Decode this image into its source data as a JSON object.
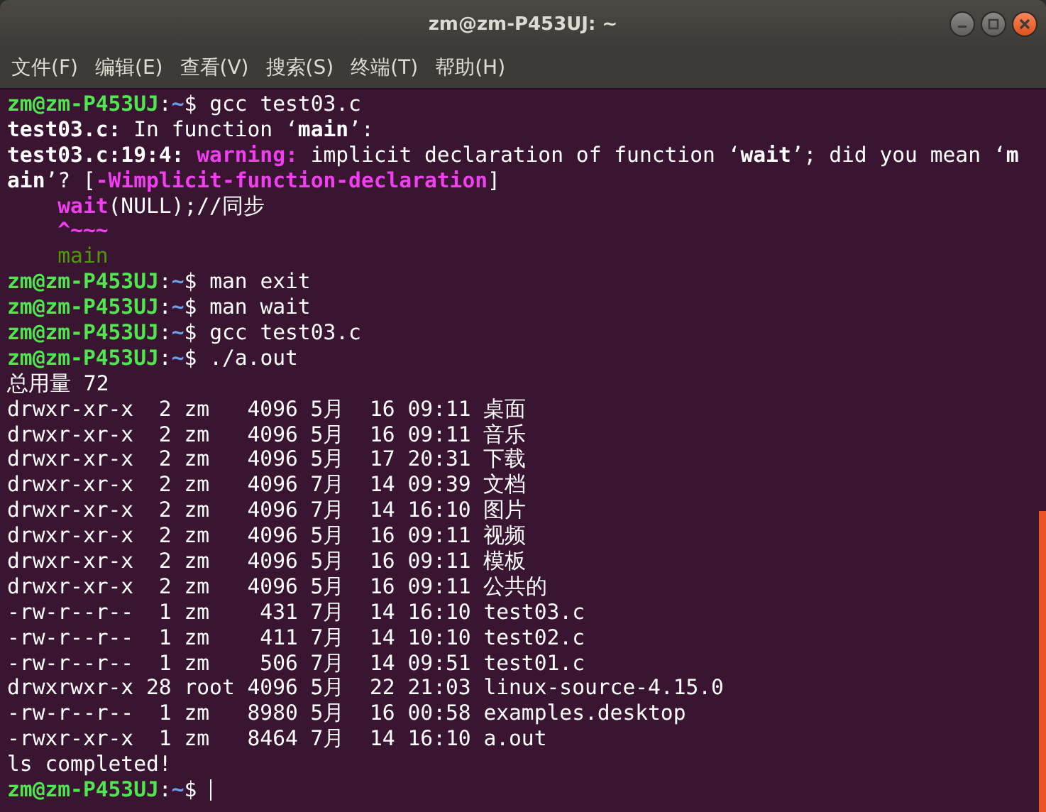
{
  "window": {
    "title": "zm@zm-P453UJ: ~"
  },
  "menu": [
    "文件(F)",
    "编辑(E)",
    "查看(V)",
    "搜索(S)",
    "终端(T)",
    "帮助(H)"
  ],
  "terminal": {
    "lines": [
      {
        "indent": false,
        "segments": [
          {
            "kind": "user",
            "text": "zm@zm-P453UJ"
          },
          {
            "kind": "plain",
            "text": ":"
          },
          {
            "kind": "path",
            "text": "~"
          },
          {
            "kind": "plain",
            "text": "$ gcc test03.c"
          }
        ]
      },
      {
        "indent": false,
        "segments": [
          {
            "kind": "bold",
            "text": "test03.c:"
          },
          {
            "kind": "plain",
            "text": " In function ‘"
          },
          {
            "kind": "bold",
            "text": "main"
          },
          {
            "kind": "plain",
            "text": "’:"
          }
        ]
      },
      {
        "indent": false,
        "segments": [
          {
            "kind": "bold",
            "text": "test03.c:19:4: "
          },
          {
            "kind": "warning",
            "text": "warning:"
          },
          {
            "kind": "plain",
            "text": " implicit declaration of function ‘"
          },
          {
            "kind": "bold",
            "text": "wait"
          },
          {
            "kind": "plain",
            "text": "’; did you mean ‘"
          },
          {
            "kind": "bold",
            "text": "m"
          }
        ]
      },
      {
        "indent": false,
        "segments": [
          {
            "kind": "bold",
            "text": "ain"
          },
          {
            "kind": "plain",
            "text": "’? ["
          },
          {
            "kind": "warning",
            "text": "-Wimplicit-function-declaration"
          },
          {
            "kind": "plain",
            "text": "]"
          }
        ]
      },
      {
        "indent": true,
        "segments": [
          {
            "kind": "caret",
            "text": "wait"
          },
          {
            "kind": "plain",
            "text": "(NULL);//同步"
          }
        ]
      },
      {
        "indent": true,
        "segments": [
          {
            "kind": "caret",
            "text": "^~~~"
          }
        ]
      },
      {
        "indent": true,
        "segments": [
          {
            "kind": "hint",
            "text": "main"
          }
        ]
      },
      {
        "indent": false,
        "segments": [
          {
            "kind": "user",
            "text": "zm@zm-P453UJ"
          },
          {
            "kind": "plain",
            "text": ":"
          },
          {
            "kind": "path",
            "text": "~"
          },
          {
            "kind": "plain",
            "text": "$ man exit"
          }
        ]
      },
      {
        "indent": false,
        "segments": [
          {
            "kind": "user",
            "text": "zm@zm-P453UJ"
          },
          {
            "kind": "plain",
            "text": ":"
          },
          {
            "kind": "path",
            "text": "~"
          },
          {
            "kind": "plain",
            "text": "$ man wait"
          }
        ]
      },
      {
        "indent": false,
        "segments": [
          {
            "kind": "user",
            "text": "zm@zm-P453UJ"
          },
          {
            "kind": "plain",
            "text": ":"
          },
          {
            "kind": "path",
            "text": "~"
          },
          {
            "kind": "plain",
            "text": "$ gcc test03.c"
          }
        ]
      },
      {
        "indent": false,
        "segments": [
          {
            "kind": "user",
            "text": "zm@zm-P453UJ"
          },
          {
            "kind": "plain",
            "text": ":"
          },
          {
            "kind": "path",
            "text": "~"
          },
          {
            "kind": "plain",
            "text": "$ ./a.out"
          }
        ]
      },
      {
        "indent": false,
        "segments": [
          {
            "kind": "plain",
            "text": "总用量 72"
          }
        ]
      },
      {
        "indent": false,
        "segments": [
          {
            "kind": "plain",
            "text": "drwxr-xr-x  2 zm   4096 5月  16 09:11 桌面"
          }
        ]
      },
      {
        "indent": false,
        "segments": [
          {
            "kind": "plain",
            "text": "drwxr-xr-x  2 zm   4096 5月  16 09:11 音乐"
          }
        ]
      },
      {
        "indent": false,
        "segments": [
          {
            "kind": "plain",
            "text": "drwxr-xr-x  2 zm   4096 5月  17 20:31 下载"
          }
        ]
      },
      {
        "indent": false,
        "segments": [
          {
            "kind": "plain",
            "text": "drwxr-xr-x  2 zm   4096 7月  14 09:39 文档"
          }
        ]
      },
      {
        "indent": false,
        "segments": [
          {
            "kind": "plain",
            "text": "drwxr-xr-x  2 zm   4096 7月  14 16:10 图片"
          }
        ]
      },
      {
        "indent": false,
        "segments": [
          {
            "kind": "plain",
            "text": "drwxr-xr-x  2 zm   4096 5月  16 09:11 视频"
          }
        ]
      },
      {
        "indent": false,
        "segments": [
          {
            "kind": "plain",
            "text": "drwxr-xr-x  2 zm   4096 5月  16 09:11 模板"
          }
        ]
      },
      {
        "indent": false,
        "segments": [
          {
            "kind": "plain",
            "text": "drwxr-xr-x  2 zm   4096 5月  16 09:11 公共的"
          }
        ]
      },
      {
        "indent": false,
        "segments": [
          {
            "kind": "plain",
            "text": "-rw-r--r--  1 zm    431 7月  14 16:10 test03.c"
          }
        ]
      },
      {
        "indent": false,
        "segments": [
          {
            "kind": "plain",
            "text": "-rw-r--r--  1 zm    411 7月  14 10:10 test02.c"
          }
        ]
      },
      {
        "indent": false,
        "segments": [
          {
            "kind": "plain",
            "text": "-rw-r--r--  1 zm    506 7月  14 09:51 test01.c"
          }
        ]
      },
      {
        "indent": false,
        "segments": [
          {
            "kind": "plain",
            "text": "drwxrwxr-x 28 root 4096 5月  22 21:03 linux-source-4.15.0"
          }
        ]
      },
      {
        "indent": false,
        "segments": [
          {
            "kind": "plain",
            "text": "-rw-r--r--  1 zm   8980 5月  16 00:58 examples.desktop"
          }
        ]
      },
      {
        "indent": false,
        "segments": [
          {
            "kind": "plain",
            "text": "-rwxr-xr-x  1 zm   8464 7月  14 16:10 a.out"
          }
        ]
      },
      {
        "indent": false,
        "segments": [
          {
            "kind": "plain",
            "text": "ls completed!"
          }
        ]
      },
      {
        "indent": false,
        "segments": [
          {
            "kind": "user",
            "text": "zm@zm-P453UJ"
          },
          {
            "kind": "plain",
            "text": ":"
          },
          {
            "kind": "path",
            "text": "~"
          },
          {
            "kind": "plain",
            "text": "$"
          }
        ]
      }
    ]
  }
}
